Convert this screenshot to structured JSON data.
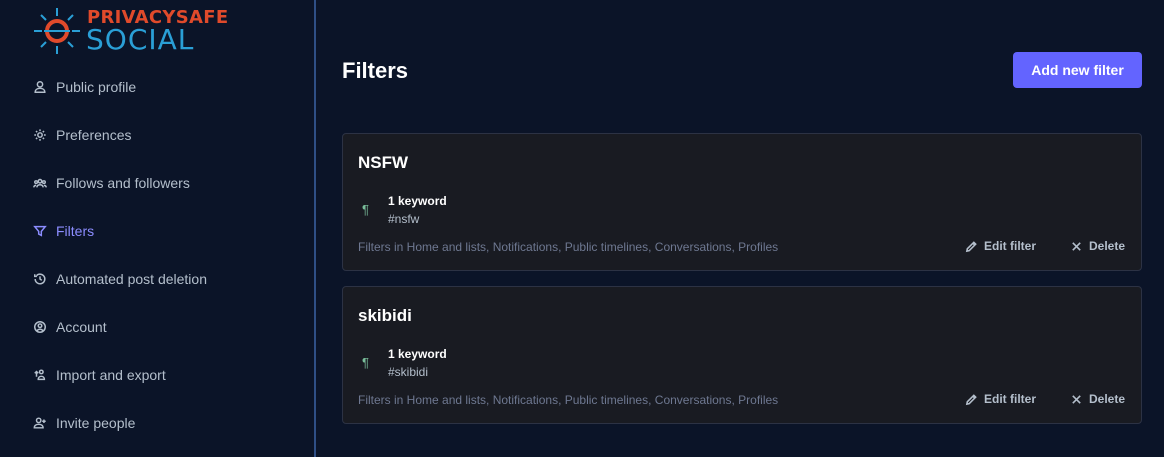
{
  "brand": {
    "top": "PRIVACYSAFE",
    "bottom": "SOCIAL",
    "colors": {
      "top": "#e04a2b",
      "bottom": "#2a9fd6",
      "accent": "#6364ff"
    }
  },
  "sidebar": {
    "items": [
      {
        "label": "Public profile",
        "icon": "user-icon"
      },
      {
        "label": "Preferences",
        "icon": "gear-icon"
      },
      {
        "label": "Follows and followers",
        "icon": "users-icon"
      },
      {
        "label": "Filters",
        "icon": "filter-icon",
        "active": true
      },
      {
        "label": "Automated post deletion",
        "icon": "history-icon"
      },
      {
        "label": "Account",
        "icon": "account-circle-icon"
      },
      {
        "label": "Import and export",
        "icon": "import-export-icon"
      },
      {
        "label": "Invite people",
        "icon": "user-plus-icon"
      }
    ]
  },
  "main": {
    "title": "Filters",
    "add_button": "Add new filter",
    "filters": [
      {
        "title": "NSFW",
        "keyword_count": "1 keyword",
        "keywords": "#nsfw",
        "context": "Filters in Home and lists, Notifications, Public timelines, Conversations, Profiles",
        "edit_label": "Edit filter",
        "delete_label": "Delete"
      },
      {
        "title": "skibidi",
        "keyword_count": "1 keyword",
        "keywords": "#skibidi",
        "context": "Filters in Home and lists, Notifications, Public timelines, Conversations, Profiles",
        "edit_label": "Edit filter",
        "delete_label": "Delete"
      }
    ]
  }
}
